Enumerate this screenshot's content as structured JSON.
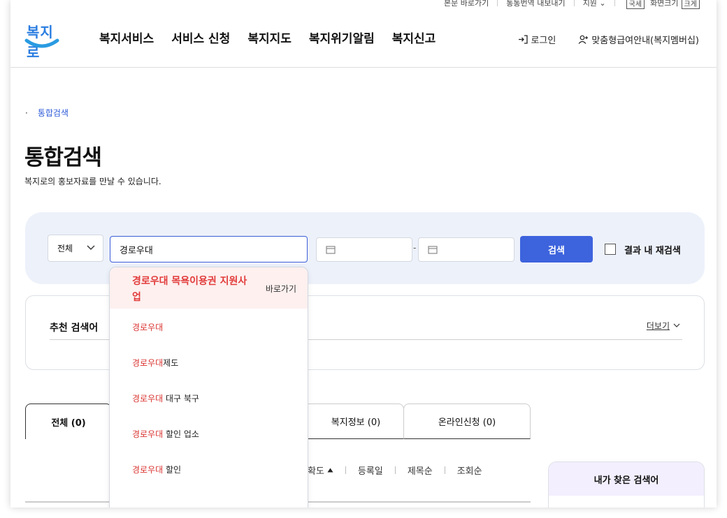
{
  "util_bar": {
    "items": [
      "본문 바로가기",
      "통통번역 내보내기",
      "지원 ⌄"
    ],
    "chips": [
      "국세",
      "화면크기",
      "크게"
    ]
  },
  "logo": {
    "text": "복지로"
  },
  "gnb": [
    "복지서비스",
    "서비스 신청",
    "복지지도",
    "복지위기알림",
    "복지신고"
  ],
  "header_links": {
    "login": "로그인",
    "membership": "맞춤형급여안내(복지멤버십)"
  },
  "breadcrumb": {
    "current": "통합검색"
  },
  "page": {
    "title": "통합검색",
    "description": "복지로의 홍보자료를 만날 수 있습니다."
  },
  "search": {
    "category": "전체",
    "query": "경로우대",
    "button": "검색",
    "date_dash": "-",
    "refine_label": "결과 내 재검색"
  },
  "autocomplete": {
    "top": {
      "text": "경로우대 목욕이용권 지원사업",
      "go": "바로가기"
    },
    "keyword": "경로우대",
    "items": [
      {
        "hl": "경로우대",
        "rest": ""
      },
      {
        "hl": "경로우대",
        "rest": "제도"
      },
      {
        "hl": "경로우대",
        "rest": " 대구 북구"
      },
      {
        "hl": "경로우대",
        "rest": " 할인 업소"
      },
      {
        "hl": "경로우대",
        "rest": " 할인"
      }
    ]
  },
  "recommend": {
    "title": "추천 검색어",
    "more": "더보기"
  },
  "tabs": {
    "all": "전체 (0)",
    "welfare_info": "복지정보 (0)",
    "online": "온라인신청 (0)"
  },
  "sort": {
    "accuracy": "확도",
    "registered": "등록일",
    "title": "제목순",
    "views": "조회순"
  },
  "side": {
    "title": "내가 찾은 검색어"
  }
}
